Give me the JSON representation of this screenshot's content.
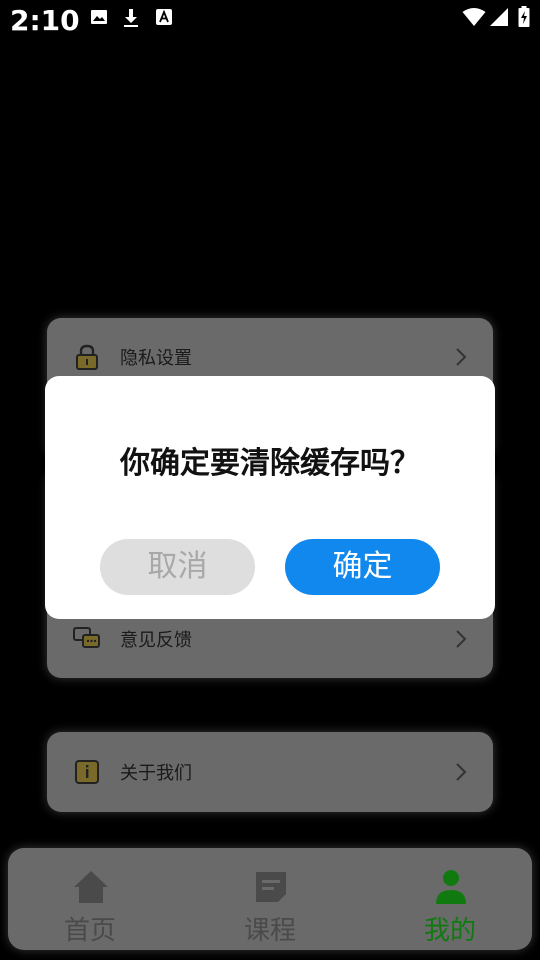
{
  "status_bar": {
    "time": "2:10",
    "left_icons": [
      "image-icon",
      "download-icon",
      "a-icon"
    ],
    "right_icons": [
      "wifi-icon",
      "signal-icon",
      "battery-icon"
    ]
  },
  "menu": {
    "group1": [
      {
        "label": "隐私设置",
        "icon": "lock-icon"
      }
    ],
    "group2": [
      {
        "label": "意见反馈",
        "icon": "chat-icon"
      }
    ],
    "group3": [
      {
        "label": "关于我们",
        "icon": "info-icon"
      }
    ]
  },
  "bottom_nav": {
    "items": [
      {
        "label": "首页",
        "icon": "home-icon",
        "active": false
      },
      {
        "label": "课程",
        "icon": "course-icon",
        "active": false
      },
      {
        "label": "我的",
        "icon": "user-icon",
        "active": true
      }
    ]
  },
  "dialog": {
    "title": "你确定要清除缓存吗？",
    "cancel_label": "取消",
    "confirm_label": "确定"
  },
  "colors": {
    "accent": "#1188ee",
    "active_nav": "#107a10",
    "inactive_nav": "#4a4a4a",
    "overlay_card": "#6a6a6a"
  }
}
